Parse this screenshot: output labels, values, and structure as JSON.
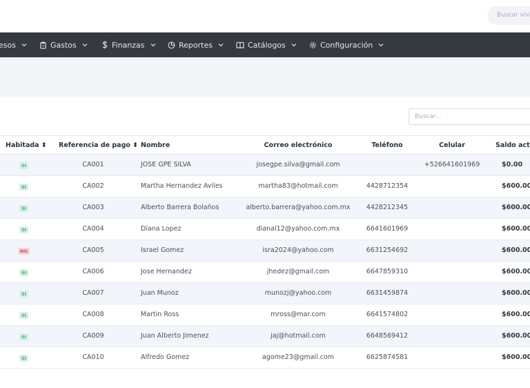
{
  "header": {
    "search_placeholder": "Buscar vivienda"
  },
  "nav": {
    "items": [
      {
        "label": "esos",
        "icon": "none"
      },
      {
        "label": "Gastos",
        "icon": "clipboard-icon"
      },
      {
        "label": "Finanzas",
        "icon": "dollar-icon"
      },
      {
        "label": "Reportes",
        "icon": "pie-chart-icon"
      },
      {
        "label": "Catálogos",
        "icon": "book-icon"
      },
      {
        "label": "Configuración",
        "icon": "gear-icon"
      }
    ]
  },
  "table": {
    "search_placeholder": "Buscar...",
    "columns": [
      "Habitada",
      "Referencia de pago",
      "Nombre",
      "Correo electrónico",
      "Teléfono",
      "Celular",
      "Saldo actual"
    ],
    "rows": [
      {
        "habitada": "SI",
        "ref": "CA001",
        "nombre": "JOSE GPE SILVA",
        "correo": "josegpe.silva@gmail.com",
        "telefono": "",
        "celular": "+526641601969",
        "saldo": "$0.00"
      },
      {
        "habitada": "SI",
        "ref": "CA002",
        "nombre": "Martha Hernandez Aviles",
        "correo": "martha83@hotmail.com",
        "telefono": "4428712354",
        "celular": "",
        "saldo": "$600.00"
      },
      {
        "habitada": "SI",
        "ref": "CA003",
        "nombre": "Alberto Barrera Bolaños",
        "correo": "alberto.barrera@yahoo.com.mx",
        "telefono": "4428212345",
        "celular": "",
        "saldo": "$600.00"
      },
      {
        "habitada": "SI",
        "ref": "CA004",
        "nombre": "Diana Lopez",
        "correo": "dianal12@yahoo.com.mx",
        "telefono": "6641601969",
        "celular": "",
        "saldo": "$600.00"
      },
      {
        "habitada": "NO",
        "ref": "CA005",
        "nombre": "Israel Gomez",
        "correo": "isra2024@yahoo.com",
        "telefono": "6631254692",
        "celular": "",
        "saldo": "$600.00"
      },
      {
        "habitada": "SI",
        "ref": "CA006",
        "nombre": "Jose Hernandez",
        "correo": "jhedez@gmail.com",
        "telefono": "6647859310",
        "celular": "",
        "saldo": "$600.00"
      },
      {
        "habitada": "SI",
        "ref": "CA007",
        "nombre": "Juan Munoz",
        "correo": "munozj@yahoo.com",
        "telefono": "6631459874",
        "celular": "",
        "saldo": "$600.00"
      },
      {
        "habitada": "SI",
        "ref": "CA008",
        "nombre": "Martin Ross",
        "correo": "mross@mar.com",
        "telefono": "6641574802",
        "celular": "",
        "saldo": "$600.00"
      },
      {
        "habitada": "SI",
        "ref": "CA009",
        "nombre": "Juan Alberto Jimenez",
        "correo": "jaj@hotmail.com",
        "telefono": "6648569412",
        "celular": "",
        "saldo": "$600.00"
      },
      {
        "habitada": "SI",
        "ref": "CA010",
        "nombre": "Alfredo Gomez",
        "correo": "agome23@gmail.com",
        "telefono": "6625874581",
        "celular": "",
        "saldo": "$600.00"
      }
    ]
  },
  "colors": {
    "navbar_bg": "#343a40",
    "badge_si": "#4aa774",
    "badge_no": "#d3455e"
  }
}
